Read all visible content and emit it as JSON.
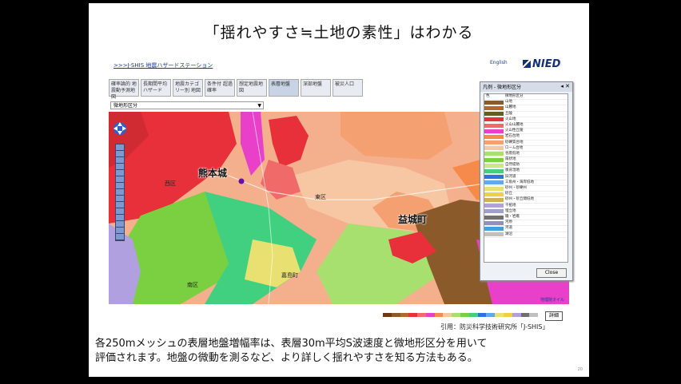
{
  "slide": {
    "title": "「揺れやすさ≒土地の素性」はわかる",
    "caption_line1": "各250mメッシュの表層地盤増幅率は、表層30m平均S波速度と微地形区分を用いて",
    "caption_line2": "評価されます。地盤の微動を測るなど、より詳しく揺れやすさを知る方法もある。",
    "citation": "引用：防災科学技術研究所「J-SHIS」",
    "page_number": "20"
  },
  "app": {
    "breadcrumb": ">>>J-SHIS 地震ハザードステーション",
    "english_link": "English",
    "logo_text": "NIED",
    "tabs": [
      {
        "label": "確率論的 地震動予測地図"
      },
      {
        "label": "長期間平均 ハザード"
      },
      {
        "label": "地震カテゴリー別 地図"
      },
      {
        "label": "条件付 超過確率"
      },
      {
        "label": "想定地震地図"
      },
      {
        "label": "表層地盤"
      },
      {
        "label": "深部地盤"
      },
      {
        "label": "被災人口"
      }
    ],
    "layer_select_value": "微地形区分",
    "detail_button": "詳細",
    "map_copyright": "地理院タイル"
  },
  "map": {
    "labels": {
      "kumamoto": "熊本城",
      "mashiki": "益城町",
      "nishi_ward": "西区",
      "higashi_ward": "東区",
      "minami_ward": "南区",
      "kashima": "嘉島町"
    }
  },
  "legend": {
    "title": "凡例 - 微地形区分",
    "header_col1": "色",
    "header_col2": "微地形区分",
    "close_label": "Close",
    "items": [
      {
        "name": "山地",
        "color": "#8b5a2b"
      },
      {
        "name": "山麓地",
        "color": "#b0682f"
      },
      {
        "name": "丘陵",
        "color": "#5f5f1f"
      },
      {
        "name": "火山地",
        "color": "#e8303a"
      },
      {
        "name": "火山山麓地",
        "color": "#f06a6a"
      },
      {
        "name": "火山性丘陵",
        "color": "#e840c8"
      },
      {
        "name": "岩石台地",
        "color": "#f58a4a"
      },
      {
        "name": "砂礫質台地",
        "color": "#f4a070"
      },
      {
        "name": "ローム台地",
        "color": "#f7c6a2"
      },
      {
        "name": "谷底低地",
        "color": "#a8e070"
      },
      {
        "name": "扇状地",
        "color": "#7ad040"
      },
      {
        "name": "自然堤防",
        "color": "#c8e888"
      },
      {
        "name": "後背湿地",
        "color": "#40d080"
      },
      {
        "name": "旧河道",
        "color": "#3070e0"
      },
      {
        "name": "三角州・海岸低地",
        "color": "#60a8f0"
      },
      {
        "name": "砂州・砂礫州",
        "color": "#e8e070"
      },
      {
        "name": "砂丘",
        "color": "#f0d040"
      },
      {
        "name": "砂州・砂丘間低地",
        "color": "#d0b050"
      },
      {
        "name": "干拓地",
        "color": "#b0a0e0"
      },
      {
        "name": "埋立地",
        "color": "#a0a0d0"
      },
      {
        "name": "磯・岩礁",
        "color": "#707070"
      },
      {
        "name": "河原",
        "color": "#9090b8"
      },
      {
        "name": "河道",
        "color": "#40a0e0"
      },
      {
        "name": "湖沼",
        "color": "#c0c0c0"
      }
    ]
  },
  "colorbar": [
    "#6b3a1a",
    "#8b5a2b",
    "#b0682f",
    "#e8303a",
    "#f06a6a",
    "#e840c8",
    "#f58a4a",
    "#f7c6a2",
    "#a8e070",
    "#7ad040",
    "#40d080",
    "#3070e0",
    "#60a8f0",
    "#e8e070",
    "#f0d040",
    "#b0a0e0",
    "#707070",
    "#c0c0c0"
  ]
}
